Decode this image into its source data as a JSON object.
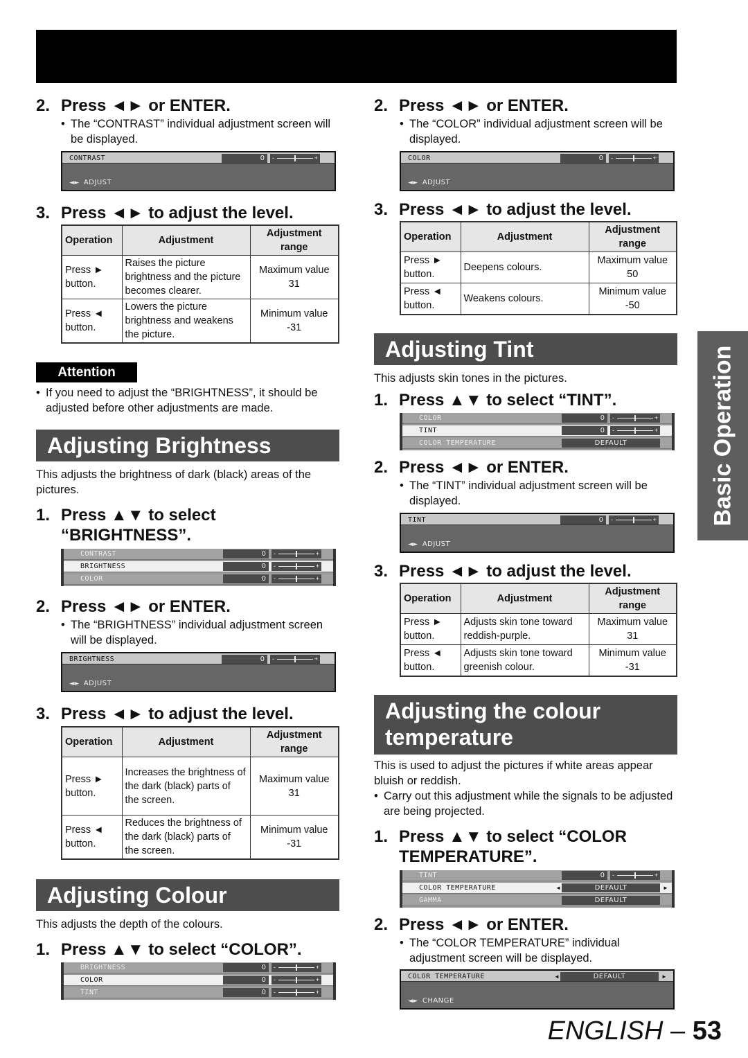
{
  "page": {
    "side_tab": "Basic Operation",
    "footer_lang": "ENGLISH",
    "footer_sep": " – ",
    "footer_page": "53"
  },
  "contrast": {
    "step2": {
      "num": "2.",
      "title": "Press ◄► or ENTER.",
      "note": "The “CONTRAST” individual adjustment screen will be displayed."
    },
    "osd": {
      "label": "CONTRAST",
      "value": "0",
      "slider_position": 0.5,
      "footer_icon": "◄►",
      "footer": "ADJUST"
    },
    "step3": {
      "num": "3.",
      "title": "Press ◄► to adjust the level."
    },
    "table": {
      "headers": [
        "Operation",
        "Adjustment",
        "Adjustment range"
      ],
      "rows": [
        [
          "Press ► button.",
          "Raises the picture brightness and the picture becomes clearer.",
          "Maximum value 31"
        ],
        [
          "Press ◄ button.",
          "Lowers the picture brightness and weakens the picture.",
          "Minimum value -31"
        ]
      ]
    }
  },
  "attention": {
    "label": "Attention",
    "note": "If you need to adjust the “BRIGHTNESS”, it should be adjusted before other adjustments are made."
  },
  "brightness": {
    "heading": "Adjusting Brightness",
    "intro": "This adjusts the brightness of dark (black) areas of the pictures.",
    "step1": {
      "num": "1.",
      "line1": "Press ▲▼ to select",
      "line2": "“BRIGHTNESS”."
    },
    "menu": [
      {
        "label": "CONTRAST",
        "value": "0",
        "selected": false
      },
      {
        "label": "BRIGHTNESS",
        "value": "0",
        "selected": true
      },
      {
        "label": "COLOR",
        "value": "0",
        "selected": false
      }
    ],
    "step2": {
      "num": "2.",
      "title": "Press ◄► or ENTER.",
      "note": "The “BRIGHTNESS” individual adjustment screen will be displayed."
    },
    "osd": {
      "label": "BRIGHTNESS",
      "value": "0",
      "slider_position": 0.5,
      "footer_icon": "◄►",
      "footer": "ADJUST"
    },
    "step3": {
      "num": "3.",
      "title": "Press ◄► to adjust the level."
    },
    "table": {
      "headers": [
        "Operation",
        "Adjustment",
        "Adjustment range"
      ],
      "rows": [
        [
          "Press ► button.",
          "Increases the brightness of the dark (black) parts of the screen.",
          "Maximum value 31"
        ],
        [
          "Press ◄ button.",
          "Reduces the brightness of the dark (black) parts of the screen.",
          "Minimum value -31"
        ]
      ]
    }
  },
  "colour": {
    "heading": "Adjusting Colour",
    "intro": "This adjusts the depth of the colours.",
    "step1": {
      "num": "1.",
      "title": "Press ▲▼ to select “COLOR”."
    },
    "menu": [
      {
        "label": "BRIGHTNESS",
        "value": "0",
        "selected": false
      },
      {
        "label": "COLOR",
        "value": "0",
        "selected": true
      },
      {
        "label": "TINT",
        "value": "0",
        "selected": false
      }
    ],
    "step2": {
      "num": "2.",
      "title": "Press ◄► or ENTER.",
      "note": "The “COLOR” individual adjustment screen will be displayed."
    },
    "osd": {
      "label": "COLOR",
      "value": "0",
      "slider_position": 0.5,
      "footer_icon": "◄►",
      "footer": "ADJUST"
    },
    "step3": {
      "num": "3.",
      "title": "Press ◄► to adjust the level."
    },
    "table": {
      "headers": [
        "Operation",
        "Adjustment",
        "Adjustment range"
      ],
      "rows": [
        [
          "Press ► button.",
          "Deepens colours.",
          "Maximum value 50"
        ],
        [
          "Press ◄ button.",
          "Weakens colours.",
          "Minimum value -50"
        ]
      ]
    }
  },
  "tint": {
    "heading": "Adjusting Tint",
    "intro": "This adjusts skin tones in the pictures.",
    "step1": {
      "num": "1.",
      "title": "Press ▲▼ to select “TINT”."
    },
    "menu": [
      {
        "label": "COLOR",
        "value": "0",
        "selected": false
      },
      {
        "label": "TINT",
        "value": "0",
        "selected": true
      },
      {
        "label": "COLOR TEMPERATURE",
        "value": "DEFAULT",
        "selected": false
      }
    ],
    "step2": {
      "num": "2.",
      "title": "Press ◄► or ENTER.",
      "note": "The “TINT” individual adjustment screen will be displayed."
    },
    "osd": {
      "label": "TINT",
      "value": "0",
      "slider_position": 0.5,
      "footer_icon": "◄►",
      "footer": "ADJUST"
    },
    "step3": {
      "num": "3.",
      "title": "Press ◄► to adjust the level."
    },
    "table": {
      "headers": [
        "Operation",
        "Adjustment",
        "Adjustment range"
      ],
      "rows": [
        [
          "Press ► button.",
          "Adjusts skin tone toward reddish-purple.",
          "Maximum value 31"
        ],
        [
          "Press ◄ button.",
          "Adjusts skin tone toward greenish colour.",
          "Minimum value -31"
        ]
      ]
    }
  },
  "colour_temp": {
    "heading_line1": "Adjusting the colour",
    "heading_line2": "temperature",
    "intro": "This is used to adjust the pictures if white areas appear bluish or reddish.",
    "note": "Carry out this adjustment while the signals to be adjusted are being projected.",
    "step1": {
      "num": "1.",
      "line1": "Press ▲▼ to select “COLOR",
      "line2": "TEMPERATURE”."
    },
    "menu": [
      {
        "label": "TINT",
        "value": "0",
        "selected": false
      },
      {
        "label": "COLOR TEMPERATURE",
        "value": "DEFAULT",
        "selected": true
      },
      {
        "label": "GAMMA",
        "value": "DEFAULT",
        "selected": false
      }
    ],
    "step2": {
      "num": "2.",
      "title": "Press ◄► or ENTER.",
      "note": "The “COLOR TEMPERATURE” individual adjustment screen will be displayed."
    },
    "osd": {
      "label": "COLOR TEMPERATURE",
      "value": "DEFAULT",
      "footer_icon": "◄►",
      "footer": "CHANGE"
    }
  },
  "bullet": "•",
  "arrow_left": "◄",
  "arrow_right": "►"
}
